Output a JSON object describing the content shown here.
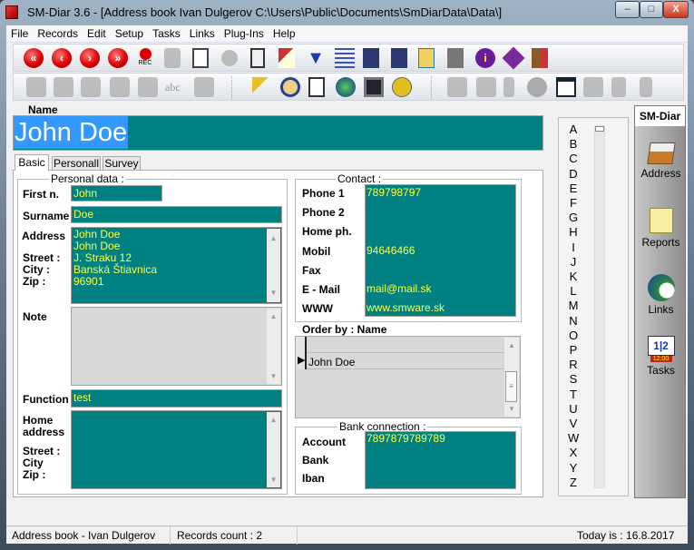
{
  "window": {
    "title": "SM-Diar 3.6 - [Address book  Ivan Dulgerov  C:\\Users\\Public\\Documents\\SmDiarData\\Data\\]",
    "min": "–",
    "max": "□",
    "close": "X"
  },
  "menu": [
    "File",
    "Records",
    "Edit",
    "Setup",
    "Tasks",
    "Links",
    "Plug-Ins",
    "Help"
  ],
  "toolbar1": {
    "first": "«",
    "prev": "‹",
    "next": "›",
    "last": "»",
    "rec_label": "REC",
    "icons": [
      "first-record-icon",
      "previous-record-icon",
      "next-record-icon",
      "last-record-icon",
      "record-icon",
      "save-icon",
      "edit-icon",
      "cancel-icon",
      "delete-icon",
      "clear-icon",
      "filter-icon",
      "list-icon",
      "import-icon",
      "export-icon",
      "copy-icon",
      "tools-icon",
      "info-icon",
      "help-book-icon",
      "exit-door-icon"
    ]
  },
  "toolbar2": {
    "abc": "abc",
    "icons": [
      "print-icon",
      "report-icon",
      "fax-icon",
      "book-icon",
      "columns-icon",
      "spell-icon",
      "print-setup-icon",
      "key-icon",
      "user-icon",
      "cards-icon",
      "internet-icon",
      "monitor-icon",
      "phone-icon",
      "paste-icon",
      "grid-icon",
      "lightning-icon",
      "circle-icon",
      "calendar-icon",
      "users-icon",
      "add-doc-icon",
      "run-icon"
    ]
  },
  "name": {
    "label": "Name",
    "value": "John Doe"
  },
  "tabs": [
    "Basic",
    "Personall",
    "Survey"
  ],
  "personal": {
    "title": "Personal data :",
    "first_label": "First n.",
    "first": "John",
    "surname_label": "Surname",
    "surname": "Doe",
    "address_label": "Address",
    "street_label": "Street :",
    "city_label": "City :",
    "zip_label": "Zip :",
    "address_lines": [
      "John Doe",
      "John Doe",
      "J. Straku 12",
      "Banská Štiavnica",
      "96901"
    ],
    "note_label": "Note",
    "function_label": "Function",
    "function": "test",
    "home_label1": "Home",
    "home_label2": "address",
    "home_street": "Street :",
    "home_city": "City",
    "home_zip": "Zip :"
  },
  "contact": {
    "title": "Contact :",
    "rows": [
      {
        "label": "Phone 1",
        "value": "789798797"
      },
      {
        "label": "Phone 2",
        "value": ""
      },
      {
        "label": "Home ph.",
        "value": ""
      },
      {
        "label": "Mobil",
        "value": "94646466"
      },
      {
        "label": "Fax",
        "value": ""
      },
      {
        "label": "E - Mail",
        "value": "mail@mail.sk"
      },
      {
        "label": "WWW",
        "value": "www.smware.sk"
      }
    ]
  },
  "order": {
    "label": "Order by : Name",
    "rows": [
      "",
      "John Doe"
    ]
  },
  "bank": {
    "title": "Bank connection :",
    "rows": [
      {
        "label": "Account",
        "value": "7897879789789"
      },
      {
        "label": "Bank",
        "value": ""
      },
      {
        "label": "Iban",
        "value": ""
      }
    ]
  },
  "alphabet": [
    "A",
    "B",
    "C",
    "D",
    "E",
    "F",
    "G",
    "H",
    "I",
    "J",
    "K",
    "L",
    "M",
    "N",
    "O",
    "P",
    "R",
    "S",
    "T",
    "U",
    "V",
    "W",
    "X",
    "Y",
    "Z"
  ],
  "sidebar": {
    "title": "SM-Diar",
    "items": [
      {
        "label": "Address",
        "icon": "address-box-icon"
      },
      {
        "label": "Reports",
        "icon": "printer-icon"
      },
      {
        "label": "Links",
        "icon": "globe-doc-icon"
      },
      {
        "label": "Tasks",
        "icon": "calendar-clock-icon",
        "clock": "12:00"
      }
    ]
  },
  "status": {
    "left": "Address book - Ivan Dulgerov",
    "count": "Records count : 2",
    "today": "Today is : 16.8.2017"
  },
  "colors": {
    "field": "#008080",
    "field_text": "#ffff40",
    "selection": "#3399ff"
  }
}
